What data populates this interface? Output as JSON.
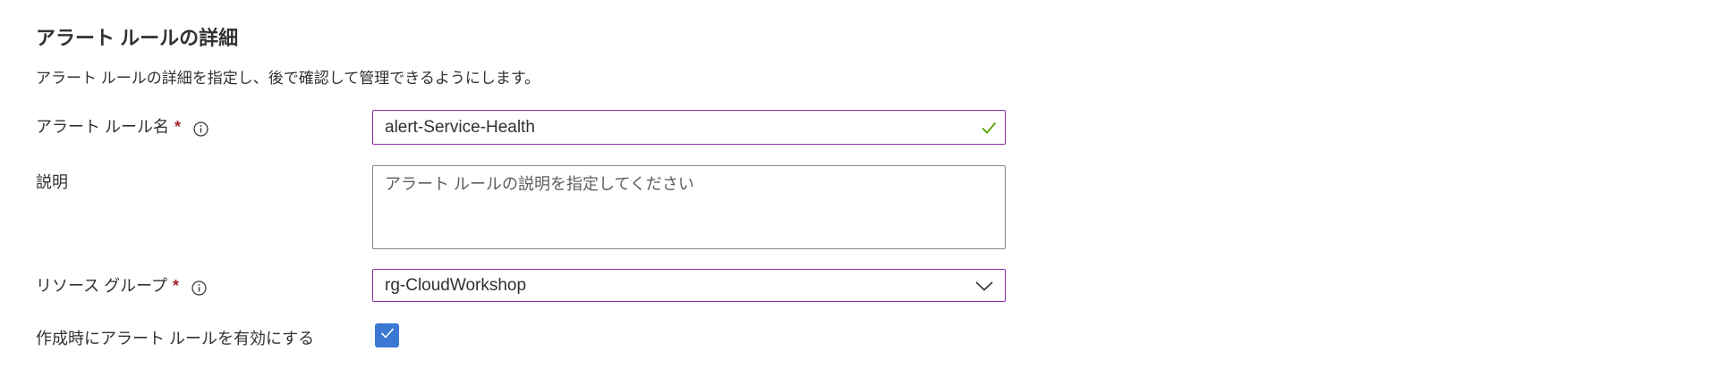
{
  "section": {
    "title": "アラート ルールの詳細",
    "description": "アラート ルールの詳細を指定し、後で確認して管理できるようにします。"
  },
  "fields": {
    "rule_name": {
      "label": "アラート ルール名",
      "required_mark": "*",
      "value": "alert-Service-Health",
      "valid": true
    },
    "description": {
      "label": "説明",
      "placeholder": "アラート ルールの説明を指定してください",
      "value": ""
    },
    "resource_group": {
      "label": "リソース グループ",
      "required_mark": "*",
      "selected": "rg-CloudWorkshop"
    },
    "enable_on_create": {
      "label": "作成時にアラート ルールを有効にする",
      "checked": true
    }
  },
  "icons": {
    "info": "info-icon",
    "valid": "checkmark-icon",
    "dropdown": "chevron-down-icon",
    "checkbox": "checkbox-checked-icon"
  },
  "colors": {
    "focus_border": "#8a2da5",
    "valid_check": "#57a300",
    "required": "#a4262c",
    "checkbox": "#3a78d4"
  }
}
